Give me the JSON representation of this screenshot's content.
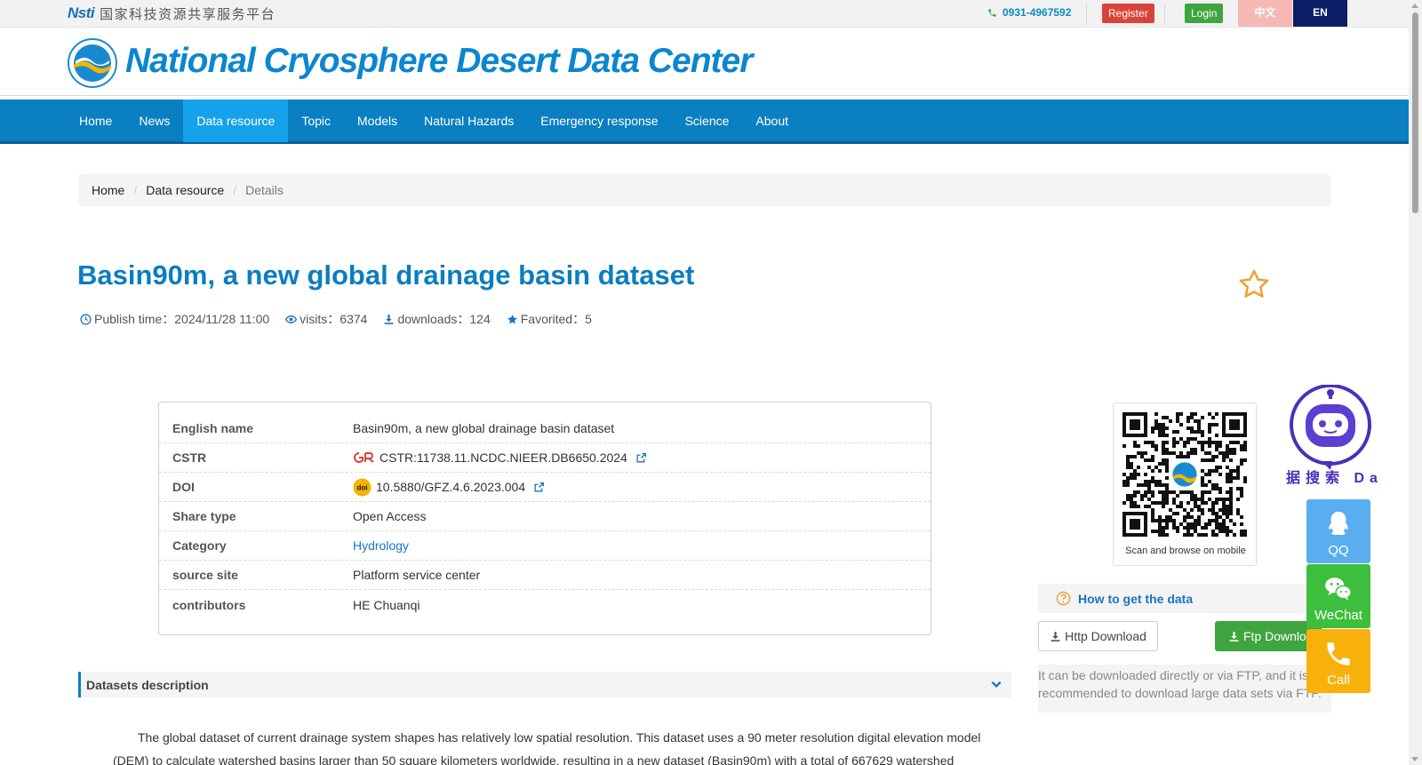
{
  "topbar": {
    "nsti_logo_text": "Nsti",
    "platform_name": "国家科技资源共享服务平台",
    "phone": "0931-4967592",
    "register": "Register",
    "login": "Login",
    "lang_cn": "中文",
    "lang_en": "EN"
  },
  "header": {
    "site_title": "National Cryosphere Desert Data Center"
  },
  "nav": {
    "items": [
      "Home",
      "News",
      "Data resource",
      "Topic",
      "Models",
      "Natural Hazards",
      "Emergency response",
      "Science",
      "About"
    ],
    "active": "Data resource"
  },
  "breadcrumb": {
    "home": "Home",
    "section": "Data resource",
    "current": "Details",
    "divider": "/"
  },
  "dataset": {
    "title": "Basin90m, a new global drainage basin dataset",
    "publish_time": "Publish time：2024/11/28 11:00",
    "visits": "visits：6374",
    "downloads": "downloads：124",
    "favorited": "Favorited：5"
  },
  "info": {
    "rows": [
      {
        "label": "English name",
        "value": "Basin90m, a new global drainage basin dataset"
      },
      {
        "label": "CSTR",
        "value": "CSTR:11738.11.NCDC.NIEER.DB6650.2024"
      },
      {
        "label": "DOI",
        "value": "10.5880/GFZ.4.6.2023.004"
      },
      {
        "label": "Share type",
        "value": "Open Access"
      },
      {
        "label": "Category",
        "value": "Hydrology"
      },
      {
        "label": "source site",
        "value": "Platform service center"
      },
      {
        "label": "contributors",
        "value": "HE Chuanqi"
      }
    ]
  },
  "description": {
    "heading": "Datasets description",
    "text": "The global dataset of current drainage system shapes has relatively low spatial resolution. This dataset uses a 90 meter resolution digital elevation model (DEM) to calculate watershed basins larger than 50 square kilometers worldwide, resulting in a new dataset (Basin90m) with a total of 667629 watershed"
  },
  "sidebar": {
    "qr_caption": "Scan and browse on mobile",
    "robot_label": "据搜索 Da",
    "howto": "How to get the data",
    "http_download": "Http Download",
    "ftp_download": "Ftp Download",
    "download_note": "It can be downloaded directly or via FTP, and it is recommended to download large data sets via FTP."
  },
  "float": {
    "qq": "QQ",
    "wechat": "WeChat",
    "call": "Call"
  },
  "colors": {
    "primary": "#0a7fc1",
    "nav_active": "#15a2ea",
    "title_blue": "#0b7dc0",
    "register_red": "#d9433a",
    "login_green": "#3fa53f"
  }
}
